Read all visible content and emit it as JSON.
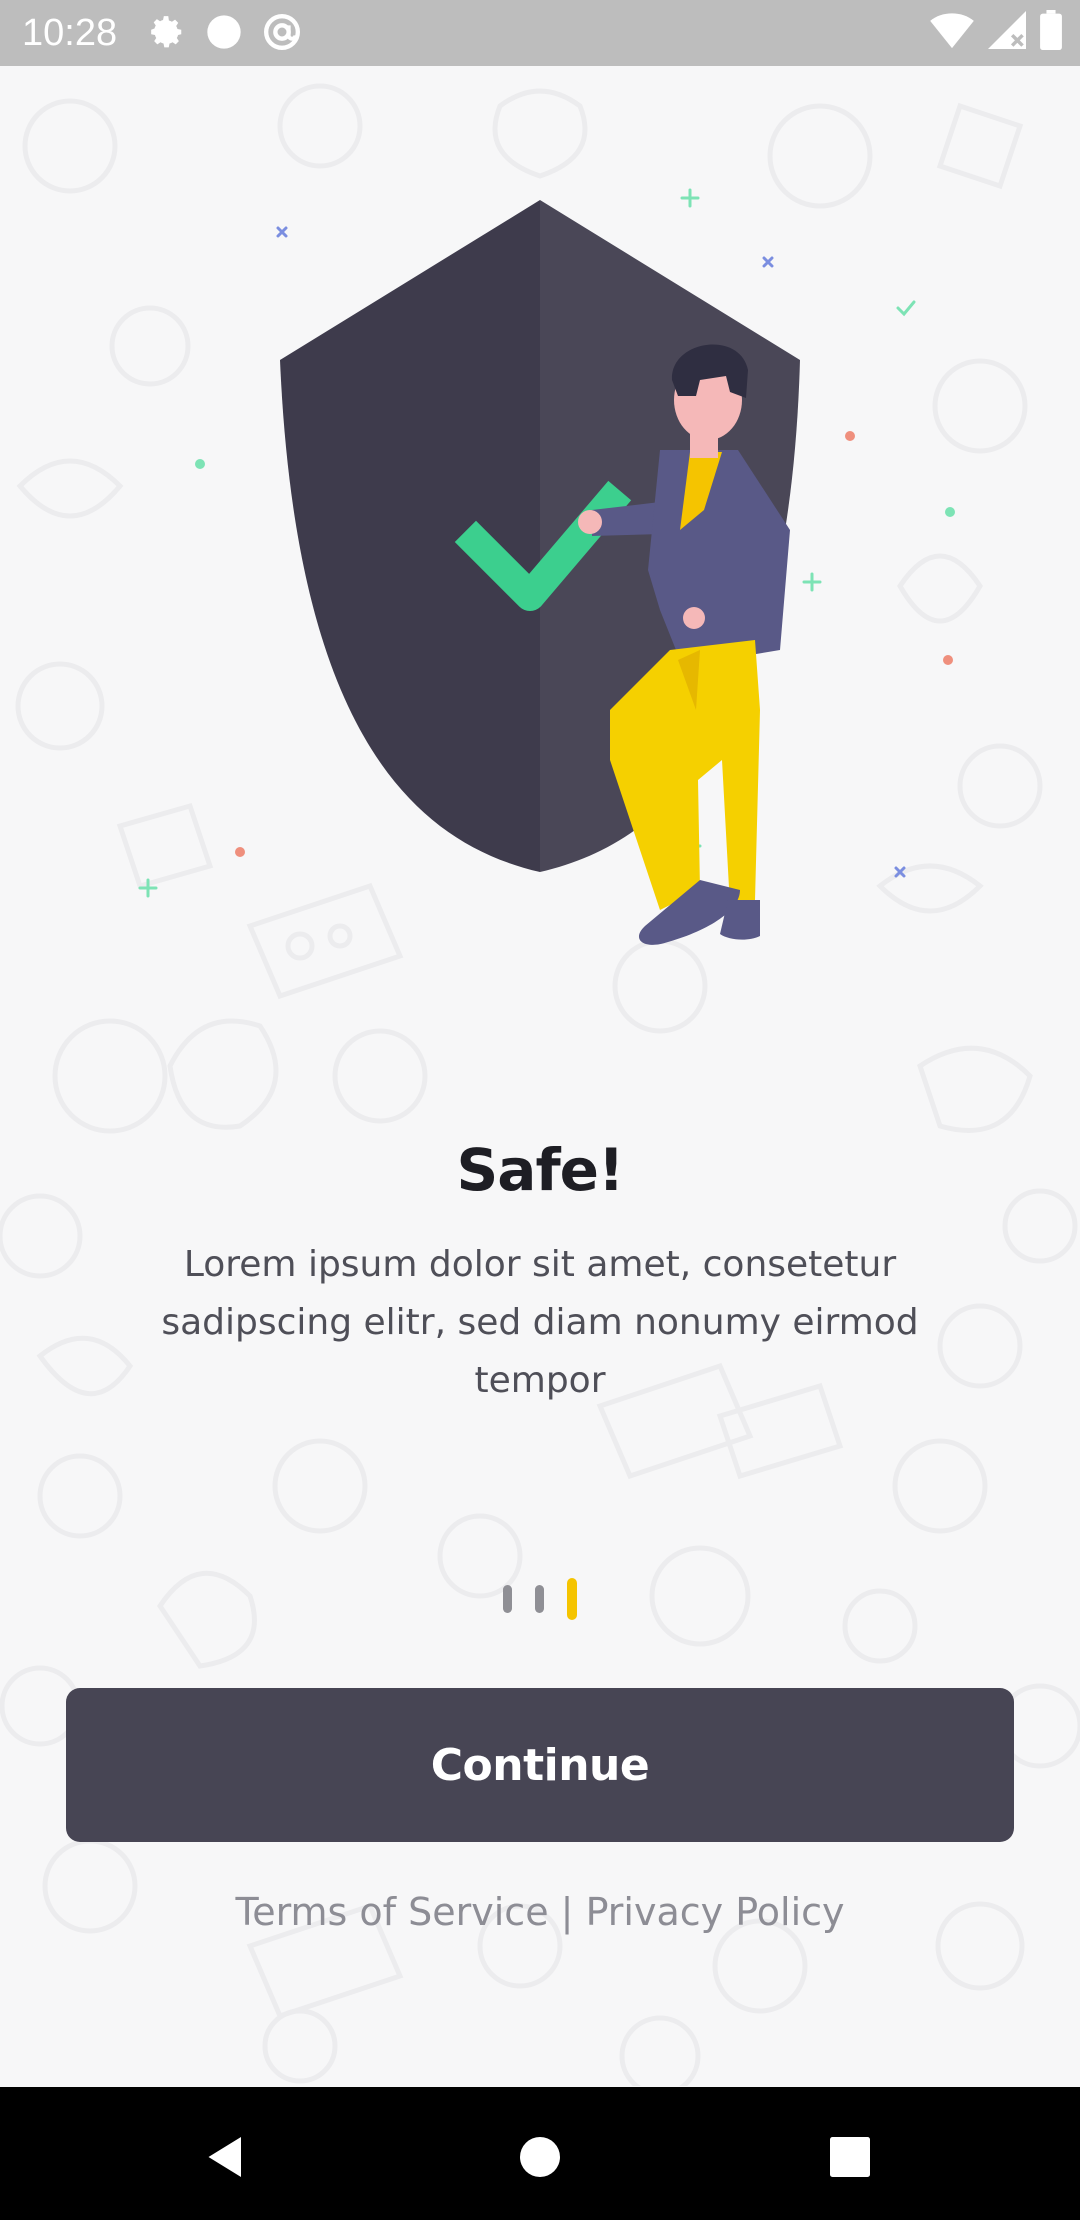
{
  "status_bar": {
    "time": "10:28",
    "left_icons": [
      "settings-icon",
      "circle-icon",
      "at-sign-icon"
    ],
    "right_icons": [
      "wifi-icon",
      "signal-icon",
      "battery-icon"
    ]
  },
  "onboarding": {
    "title": "Safe!",
    "description": "Lorem ipsum dolor sit amet, consetetur sadipscing elitr, sed diam nonumy eirmod tempor",
    "page_count": 3,
    "active_page": 3,
    "continue_label": "Continue",
    "terms_label": "Terms of Service",
    "separator": " | ",
    "privacy_label": "Privacy Policy"
  },
  "colors": {
    "accent": "#f5c400",
    "button": "#474554",
    "check": "#3ccf8e",
    "shield_dark": "#3e3b4c",
    "shield_light": "#4a4757",
    "jacket": "#595987"
  },
  "nav_bar": {
    "icons": [
      "back-icon",
      "home-icon",
      "recents-icon"
    ]
  }
}
